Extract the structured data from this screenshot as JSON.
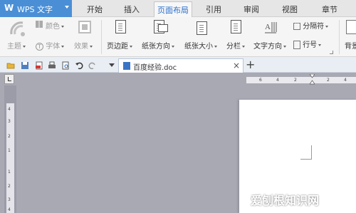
{
  "app": {
    "logo": "W",
    "name": "WPS 文字"
  },
  "tabs": [
    "开始",
    "插入",
    "页面布局",
    "引用",
    "审阅",
    "视图",
    "章节"
  ],
  "active_tab": "页面布局",
  "ribbon": {
    "theme": "主题",
    "colors": "颜色",
    "fonts": "字体",
    "effects": "效果",
    "margins": "页边距",
    "orientation": "纸张方向",
    "size": "纸张大小",
    "columns": "分栏",
    "text_direction": "文字方向",
    "separator": "分隔符",
    "line_number": "行号",
    "background": "背景"
  },
  "document": {
    "tab_name": "百度经验.doc",
    "close": "×",
    "new_tab": "+"
  },
  "hruler_numbers": [
    "6",
    "4",
    "2",
    "2",
    "4"
  ],
  "vruler_numbers": [
    "4",
    "3",
    "2",
    "1",
    "1",
    "2",
    "3",
    "4"
  ],
  "watermark": "爱刨根知识网",
  "colors": {
    "app_blue": "#4a8fd6",
    "active_tab_text": "#2a6fc9",
    "workspace": "#a9a9b4"
  }
}
